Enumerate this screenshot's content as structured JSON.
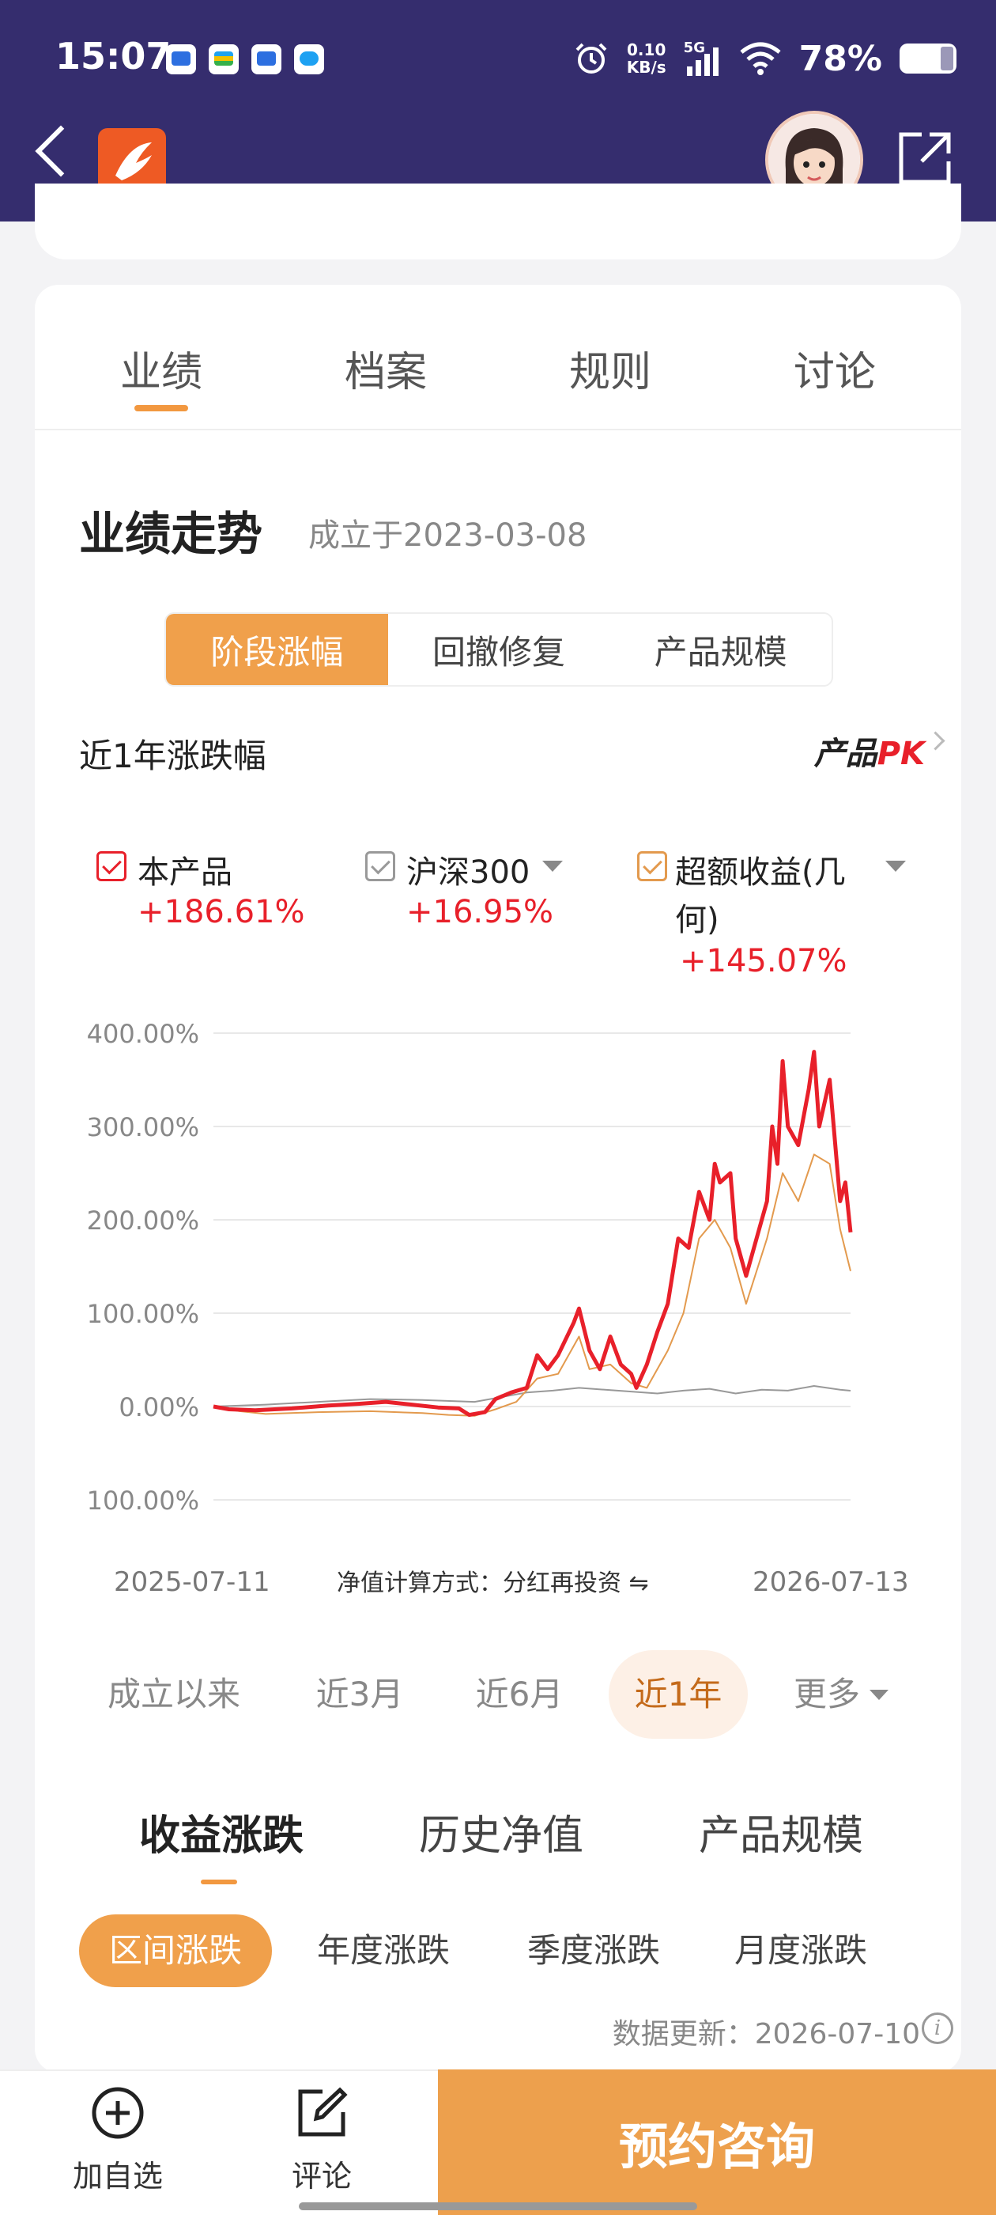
{
  "status_bar": {
    "time": "15:07",
    "net_speed_value": "0.10",
    "net_speed_unit": "KB/s",
    "network": "5G",
    "battery": "78%"
  },
  "header": {
    "back_icon": "chevron-left-icon",
    "app_logo_icon": "app-logo-icon",
    "avatar_icon": "assistant-avatar-icon",
    "share_icon": "share-icon"
  },
  "tabs": [
    {
      "label": "业绩",
      "active": true
    },
    {
      "label": "档案",
      "active": false
    },
    {
      "label": "规则",
      "active": false
    },
    {
      "label": "讨论",
      "active": false
    }
  ],
  "performance": {
    "title": "业绩走势",
    "established": "成立于2023-03-08",
    "segments": [
      {
        "label": "阶段涨幅",
        "active": true
      },
      {
        "label": "回撤修复",
        "active": false
      },
      {
        "label": "产品规模",
        "active": false
      }
    ],
    "period_label": "近1年涨跌幅",
    "pk": {
      "prefix": "产品",
      "accent": "PK"
    },
    "legend": [
      {
        "name": "本产品",
        "value": "+186.61%",
        "color": "#e8202a",
        "has_caret": false
      },
      {
        "name": "沪深300",
        "value": "+16.95%",
        "color": "#999999",
        "has_caret": true
      },
      {
        "name_line1": "超额收益(几",
        "name_line2": "何)",
        "value": "+145.07%",
        "color": "#e39a4e",
        "has_caret": true
      }
    ],
    "x_start": "2025-07-11",
    "x_end": "2026-07-13",
    "nav_method": "净值计算方式：分红再投资 ⇋",
    "ranges": [
      {
        "label": "成立以来",
        "active": false
      },
      {
        "label": "近3月",
        "active": false
      },
      {
        "label": "近6月",
        "active": false
      },
      {
        "label": "近1年",
        "active": true
      },
      {
        "label": "更多",
        "active": false
      }
    ],
    "sub_tabs": [
      {
        "label": "收益涨跌",
        "active": true
      },
      {
        "label": "历史净值",
        "active": false
      },
      {
        "label": "产品规模",
        "active": false
      }
    ],
    "pills": [
      {
        "label": "区间涨跌",
        "active": true
      },
      {
        "label": "年度涨跌",
        "active": false
      },
      {
        "label": "季度涨跌",
        "active": false
      },
      {
        "label": "月度涨跌",
        "active": false
      }
    ],
    "update_text": "数据更新：2026-07-10",
    "info_icon": "i"
  },
  "chart_data": {
    "type": "line",
    "yticks": [
      "400.00%",
      "300.00%",
      "200.00%",
      "100.00%",
      "0.00%",
      "100.00%"
    ],
    "ylim": [
      -100,
      400
    ],
    "x_labels": [
      "2025-07-11",
      "2026-07-13"
    ],
    "grid": true,
    "series": [
      {
        "name": "本产品",
        "color": "#e8202a",
        "points": [
          [
            0,
            0
          ],
          [
            0.03,
            -3
          ],
          [
            0.08,
            -4
          ],
          [
            0.15,
            -2
          ],
          [
            0.22,
            1
          ],
          [
            0.28,
            3
          ],
          [
            0.33,
            5
          ],
          [
            0.38,
            2
          ],
          [
            0.43,
            -1
          ],
          [
            0.47,
            -2
          ],
          [
            0.49,
            -9
          ],
          [
            0.52,
            -6
          ],
          [
            0.54,
            8
          ],
          [
            0.57,
            15
          ],
          [
            0.6,
            20
          ],
          [
            0.62,
            55
          ],
          [
            0.64,
            40
          ],
          [
            0.66,
            55
          ],
          [
            0.69,
            90
          ],
          [
            0.7,
            105
          ],
          [
            0.72,
            60
          ],
          [
            0.74,
            40
          ],
          [
            0.76,
            75
          ],
          [
            0.78,
            45
          ],
          [
            0.8,
            35
          ],
          [
            0.81,
            20
          ],
          [
            0.83,
            45
          ],
          [
            0.85,
            80
          ],
          [
            0.87,
            110
          ],
          [
            0.89,
            180
          ],
          [
            0.91,
            170
          ],
          [
            0.93,
            230
          ],
          [
            0.95,
            200
          ],
          [
            0.96,
            260
          ],
          [
            0.97,
            240
          ],
          [
            0.99,
            250
          ],
          [
            1.0,
            180
          ],
          [
            1.02,
            140
          ],
          [
            1.04,
            180
          ],
          [
            1.06,
            220
          ],
          [
            1.07,
            300
          ],
          [
            1.08,
            260
          ],
          [
            1.09,
            370
          ],
          [
            1.1,
            300
          ],
          [
            1.12,
            280
          ],
          [
            1.14,
            340
          ],
          [
            1.15,
            380
          ],
          [
            1.16,
            300
          ],
          [
            1.18,
            350
          ],
          [
            1.2,
            220
          ],
          [
            1.21,
            240
          ],
          [
            1.22,
            186.61
          ]
        ]
      },
      {
        "name": "沪深300",
        "color": "#999999",
        "points": [
          [
            0,
            0
          ],
          [
            0.1,
            2
          ],
          [
            0.2,
            5
          ],
          [
            0.3,
            8
          ],
          [
            0.4,
            7
          ],
          [
            0.5,
            5
          ],
          [
            0.55,
            10
          ],
          [
            0.6,
            15
          ],
          [
            0.65,
            17
          ],
          [
            0.7,
            20
          ],
          [
            0.75,
            18
          ],
          [
            0.8,
            16
          ],
          [
            0.85,
            14
          ],
          [
            0.9,
            17
          ],
          [
            0.95,
            19
          ],
          [
            1.0,
            14
          ],
          [
            1.05,
            18
          ],
          [
            1.1,
            17
          ],
          [
            1.15,
            22
          ],
          [
            1.2,
            18
          ],
          [
            1.22,
            16.95
          ]
        ]
      },
      {
        "name": "超额收益(几何)",
        "color": "#e39a4e",
        "points": [
          [
            0,
            0
          ],
          [
            0.05,
            -5
          ],
          [
            0.1,
            -8
          ],
          [
            0.2,
            -6
          ],
          [
            0.3,
            -5
          ],
          [
            0.4,
            -7
          ],
          [
            0.45,
            -9
          ],
          [
            0.5,
            -10
          ],
          [
            0.54,
            -3
          ],
          [
            0.58,
            5
          ],
          [
            0.62,
            30
          ],
          [
            0.66,
            35
          ],
          [
            0.7,
            75
          ],
          [
            0.72,
            40
          ],
          [
            0.76,
            45
          ],
          [
            0.8,
            25
          ],
          [
            0.83,
            20
          ],
          [
            0.87,
            60
          ],
          [
            0.9,
            100
          ],
          [
            0.93,
            180
          ],
          [
            0.96,
            200
          ],
          [
            0.99,
            170
          ],
          [
            1.02,
            110
          ],
          [
            1.06,
            180
          ],
          [
            1.09,
            250
          ],
          [
            1.12,
            220
          ],
          [
            1.15,
            270
          ],
          [
            1.18,
            260
          ],
          [
            1.2,
            190
          ],
          [
            1.22,
            145.07
          ]
        ]
      }
    ]
  },
  "bottom_bar": {
    "add_watch": "加自选",
    "comment": "评论",
    "cta": "预约咨询"
  }
}
